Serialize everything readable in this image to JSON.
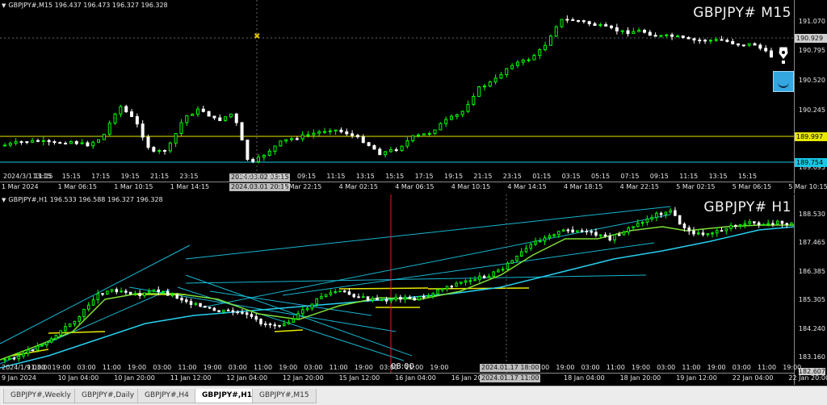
{
  "top_chart": {
    "header": "GBPJPY#,M15  196.437 196.473 196.327 196.328",
    "title": "GBPJPY# M15",
    "price_ticks": [
      "191.070",
      "190.929",
      "190.795",
      "190.520",
      "190.245",
      "189.997",
      "189.754",
      "189.695"
    ],
    "current_price": "190.929",
    "hline_yellow": "189.997",
    "hline_cyan": "189.754",
    "time_row_upper": [
      "2024/3/1 11:15",
      "13:15",
      "15:15",
      "17:15",
      "19:15",
      "21:15",
      "23:15",
      "2024.03.02 03:15",
      "05:15",
      "07:15",
      "09:15",
      "11:15",
      "13:15",
      "15:15",
      "17:15",
      "19:15",
      "21:15",
      "23:15",
      "01:15",
      "03:15",
      "05:15",
      "07:15",
      "09:15",
      "11:15",
      "13:15",
      "15:15"
    ],
    "time_row_lower": [
      "1 Mar 2024",
      "1 Mar 06:15",
      "1 Mar 10:15",
      "1 Mar 14:15",
      "2024.03.01 20:15",
      "1 Mar 22:15",
      "4 Mar 02:15",
      "4 Mar 06:15",
      "4 Mar 10:15",
      "4 Mar 14:15",
      "4 Mar 18:15",
      "4 Mar 22:15",
      "5 Mar 02:15",
      "5 Mar 06:15",
      "5 Mar 10:15"
    ]
  },
  "bottom_chart": {
    "header": "GBPJPY#,H1  196.533 196.588 196.327 196.328",
    "title": "GBPJPY# H1",
    "price_ticks": [
      "188.530",
      "187.465",
      "186.385",
      "185.305",
      "184.240",
      "183.160",
      "182.607"
    ],
    "time_row_upper": [
      "2024/1/9 03:00",
      "11:00",
      "19:00",
      "03:00",
      "11:00",
      "19:00",
      "03:00",
      "11:00",
      "19:00",
      "03:00",
      "11:00",
      "19:00",
      "03:00",
      "11:00",
      "19:00",
      "03:00",
      "11:00",
      "19:00",
      "08:00",
      "19:00",
      "03:00",
      "11:00",
      "19:00",
      "03:00",
      "11:00",
      "19:00",
      "03:00",
      "11:00",
      "19:00",
      "03:00",
      "11:00",
      "19:00"
    ],
    "time_row_lower": [
      "9 Jan 2024",
      "10 Jan 04:00",
      "10 Jan 20:00",
      "11 Jan 12:00",
      "12 Jan 04:00",
      "12 Jan 20:00",
      "15 Jan 12:00",
      "16 Jan 04:00",
      "16 Jan 20:00",
      "2024.01.17 11:00",
      "18 Jan 04:00",
      "18 Jan 20:00",
      "19 Jan 12:00",
      "22 Jan 04:00",
      "22 Jan 20:00"
    ],
    "crosshair_time": "2024.01.17 18:00"
  },
  "tabs": [
    "GBPJPY#,Weekly",
    "GBPJPY#,Daily",
    "GBPJPY#,H4",
    "GBPJPY#,H1",
    "GBPJPY#,M15"
  ],
  "active_tab": "GBPJPY#,H1",
  "colors": {
    "bull": "#00ff00",
    "bear": "#ffffff",
    "yellow_line": "#e8e800",
    "cyan_line": "#19c8e6",
    "trend": "#17b6d0",
    "ma_green": "#7fe035",
    "ma_cyan": "#26d0f0"
  }
}
